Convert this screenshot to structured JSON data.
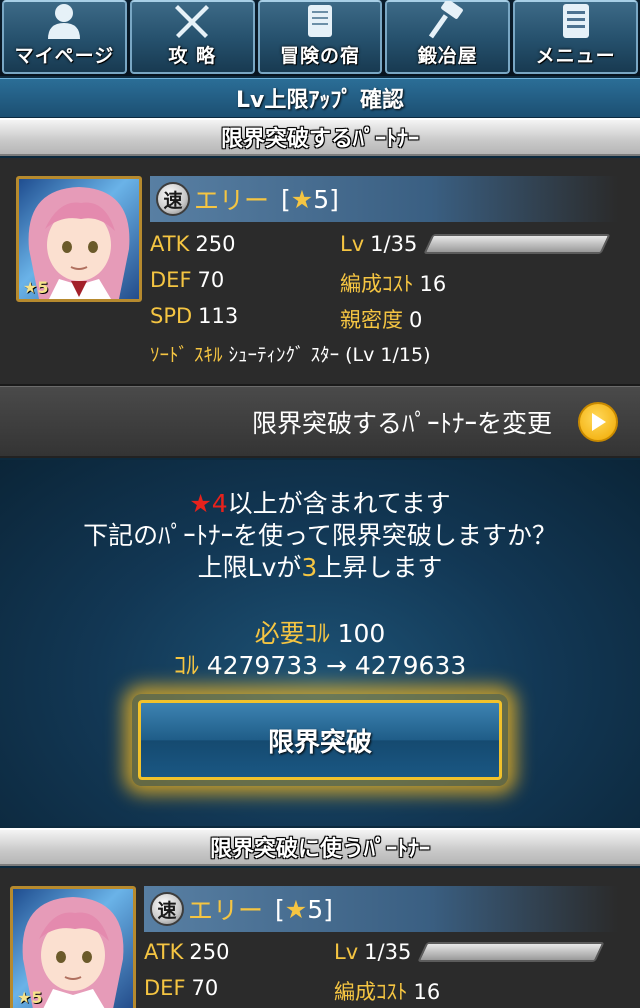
{
  "nav": {
    "items": [
      {
        "label": "マイページ",
        "icon": "person-icon"
      },
      {
        "label": "攻 略",
        "icon": "crossed-swords-icon"
      },
      {
        "label": "冒険の宿",
        "icon": "scroll-icon"
      },
      {
        "label": "鍛冶屋",
        "icon": "hammer-icon"
      },
      {
        "label": "メニュー",
        "icon": "menu-icon"
      }
    ]
  },
  "title": "Lv上限ｱｯﾌﾟ 確認",
  "section_top": "限界突破するﾊﾟｰﾄﾅｰ",
  "section_bottom": "限界突破に使うﾊﾟｰﾄﾅｰ",
  "partner_top": {
    "type_badge": "速",
    "name": "エリー",
    "rarity_open": "[",
    "rarity_star": "★",
    "rarity_value": "5",
    "rarity_close": "]",
    "portrait_badge": "★5",
    "atk_label": "ATK",
    "atk": "250",
    "def_label": "DEF",
    "def": "70",
    "spd_label": "SPD",
    "spd": "113",
    "lv_label": "Lv",
    "lv": "1/35",
    "cost_label": "編成ｺｽﾄ",
    "cost": "16",
    "affinity_label": "親密度",
    "affinity": "0",
    "skill_label": "ｿｰﾄﾞ ｽｷﾙ",
    "skill_value": "ｼｭｰﾃｨﾝｸﾞ ｽﾀｰ (Lv 1/15)"
  },
  "partner_bottom": {
    "type_badge": "速",
    "name": "エリー",
    "rarity_open": "[",
    "rarity_star": "★",
    "rarity_value": "5",
    "rarity_close": "]",
    "portrait_badge": "★5",
    "atk_label": "ATK",
    "atk": "250",
    "def_label": "DEF",
    "def": "70",
    "lv_label": "Lv",
    "lv": "1/35",
    "cost_label": "編成ｺｽﾄ",
    "cost": "16"
  },
  "change_partner": "限界突破するﾊﾟｰﾄﾅｰを変更",
  "confirm": {
    "warn_star": "★4",
    "warn_text": "以上が含まれてます",
    "question": "下記のﾊﾟｰﾄﾅｰを使って限界突破しますか？",
    "rise_prefix": "上限Lvが",
    "rise_value": "3",
    "rise_suffix": "上昇します",
    "required_label": "必要ｺﾙ",
    "required_value": "100",
    "col_label": "ｺﾙ",
    "col_change": "4279733 → 4279633",
    "button": "限界突破"
  },
  "colors": {
    "accent_yellow": "#f5c542",
    "warn_red": "#e8221c",
    "button_border": "#f2c22b"
  }
}
